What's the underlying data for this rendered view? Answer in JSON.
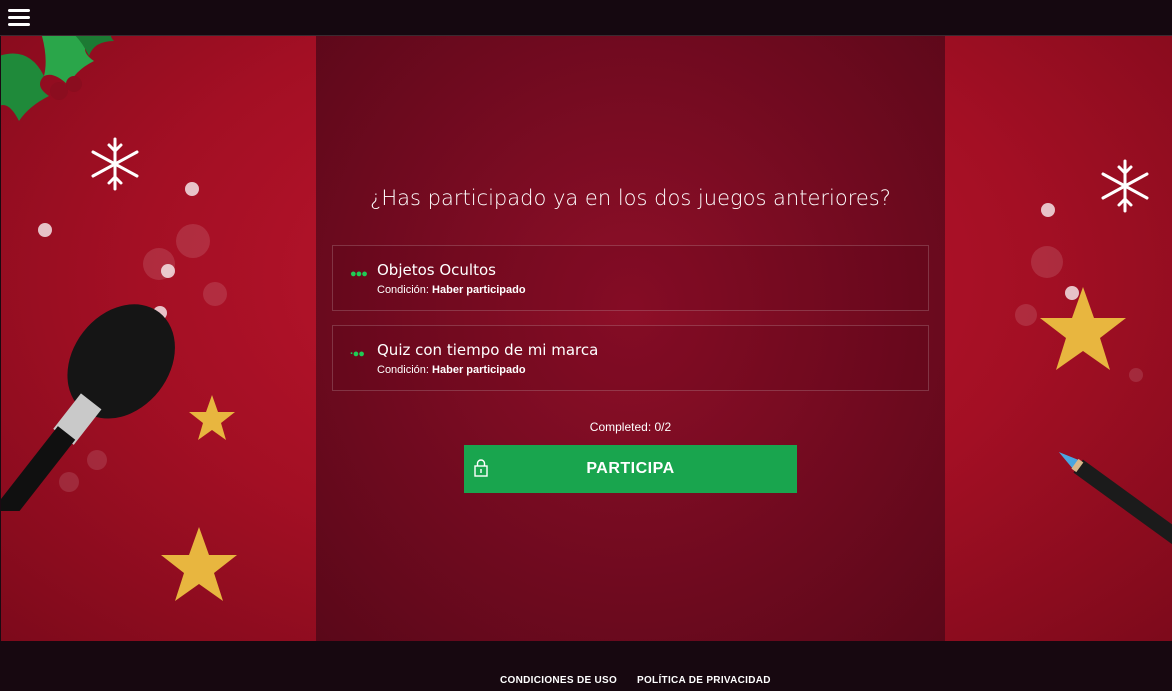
{
  "header": {
    "menu_icon": "hamburger-menu-icon"
  },
  "game": {
    "question": "¿Has participado ya en los dos juegos anteriores?",
    "items": [
      {
        "name": "Objetos Ocultos",
        "condition_label": "Condición:",
        "condition_value": "Haber participado"
      },
      {
        "name": "Quiz con tiempo de mi marca",
        "condition_label": "Condición:",
        "condition_value": "Haber participado"
      }
    ],
    "completed": "Completed: 0/2",
    "cta_label": "PARTICIPA",
    "cta_icon": "lock-icon"
  },
  "footer": {
    "terms": "CONDICIONES DE USO",
    "privacy": "POLÍTICA DE PRIVACIDAD"
  },
  "colors": {
    "accent_green": "#19a54e",
    "background_red": "#a30f24",
    "panel_red": "#6f0a1f"
  }
}
